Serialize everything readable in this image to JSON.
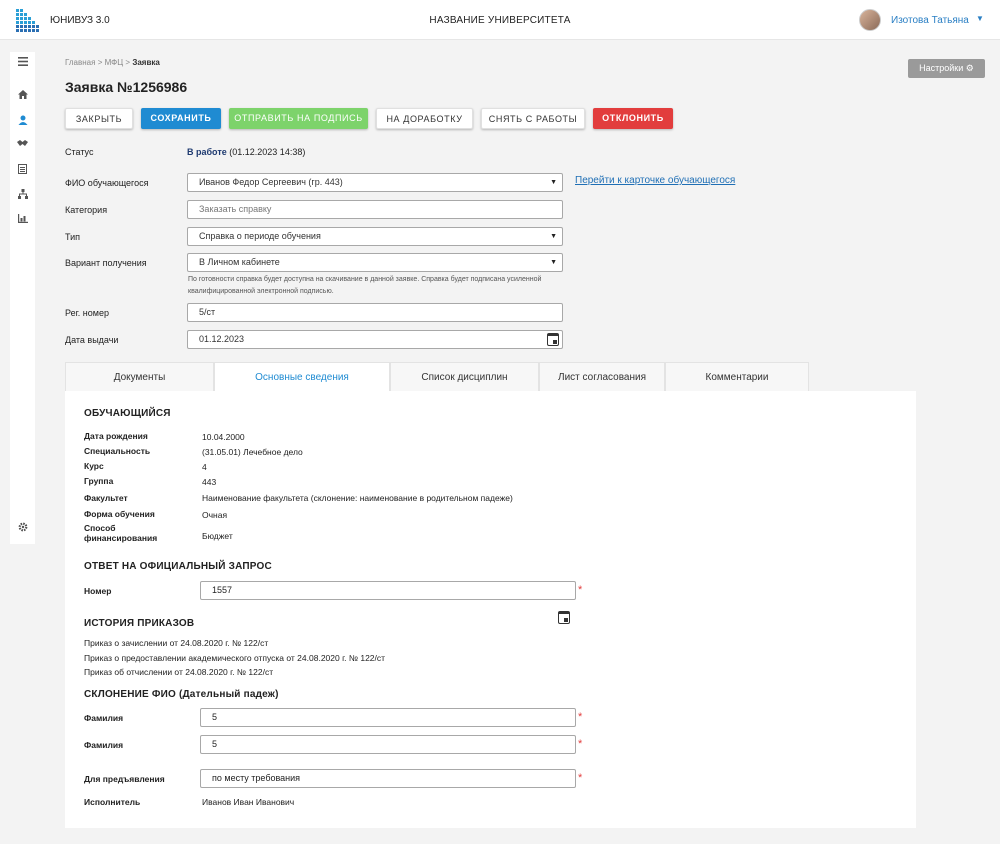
{
  "header": {
    "app_name": "ЮНИВУЗ 3.0",
    "university": "НАЗВАНИЕ УНИВЕРСИТЕТА",
    "user_name": "Изотова Татьяна",
    "user_caret": "▼"
  },
  "sidebar": {
    "icons": [
      "menu-icon",
      "home-icon",
      "user-icon",
      "handshake-icon",
      "document-icon",
      "hierarchy-icon",
      "chart-icon"
    ],
    "bottom_icon": "gear-icon"
  },
  "breadcrumb": {
    "items": [
      "Главная",
      "МФЦ"
    ],
    "current": "Заявка",
    "separator": ">"
  },
  "page_title": "Заявка №1256986",
  "settings_label": "Настройки",
  "toolbar": {
    "close": "ЗАКРЫТЬ",
    "save": "СОХРАНИТЬ",
    "send": "ОТПРАВИТЬ НА ПОДПИСЬ",
    "rework": "НА ДОРАБОТКУ",
    "withdraw": "СНЯТЬ С РАБОТЫ",
    "reject": "ОТКЛОНИТЬ"
  },
  "form": {
    "status_label": "Статус",
    "status_value": "В работе",
    "status_date": "(01.12.2023 14:38)",
    "student_label": "ФИО обучающегося",
    "student_value": "Иванов Федор Сергеевич (гр. 443)",
    "student_link": "Перейти к карточке обучающегося",
    "category_label": "Категория",
    "category_placeholder": "Заказать справку",
    "type_label": "Тип",
    "type_value": "Справка о периоде обучения",
    "receive_label": "Вариант получения",
    "receive_value": "В Личном кабинете",
    "receive_hint": "По готовности справка будет доступна на скачивание в данной заявке. Справка будет подписана усиленной квалифицированной электронной подписью.",
    "reg_label": "Рег. номер",
    "reg_value": "5/ст",
    "date_label": "Дата выдачи",
    "date_value": "01.12.2023"
  },
  "tabs": [
    "Документы",
    "Основные сведения",
    "Список дисциплин",
    "Лист согласования",
    "Комментарии"
  ],
  "active_tab": "Основные сведения",
  "student_section": {
    "title": "ОБУЧАЮЩИЙСЯ",
    "rows": [
      {
        "label": "Дата рождения",
        "value": "10.04.2000"
      },
      {
        "label": "Специальность",
        "value": "(31.05.01) Лечебное дело"
      },
      {
        "label": "Курс",
        "value": "4"
      },
      {
        "label": "Группа",
        "value": "443"
      },
      {
        "label": "Факультет",
        "value": "Наименование факультета (склонение: наименование в родительном падеже)"
      },
      {
        "label": "Форма обучения",
        "value": "Очная"
      },
      {
        "label": "Способ финансирования",
        "value": "Бюджет"
      }
    ]
  },
  "response_section": {
    "title": "ОТВЕТ НА ОФИЦИАЛЬНЫЙ ЗАПРОС",
    "number_label": "Номер",
    "number_value": "1557"
  },
  "orders_section": {
    "title": "ИСТОРИЯ ПРИКАЗОВ",
    "items": [
      "Приказ о зачислении от 24.08.2020 г. № 122/ст",
      "Приказ о предоставлении академического отпуска от 24.08.2020 г. № 122/ст",
      "Приказ об отчислении от 24.08.2020 г. № 122/ст"
    ]
  },
  "declension_section": {
    "title": "СКЛОНЕНИЕ ФИО (Дательный падеж)",
    "surname1_label": "Фамилия",
    "surname1_value": "5",
    "surname2_label": "Фамилия",
    "surname2_value": "5",
    "present_label": "Для предъявления",
    "present_value": "по месту требования",
    "executor_label": "Исполнитель",
    "executor_value": "Иванов Иван Иванович"
  },
  "required_mark": "*",
  "colors": {
    "primary": "#1f8bd2",
    "success": "#7dd36b",
    "danger": "#e23d3d",
    "link": "#1f6fb5"
  }
}
